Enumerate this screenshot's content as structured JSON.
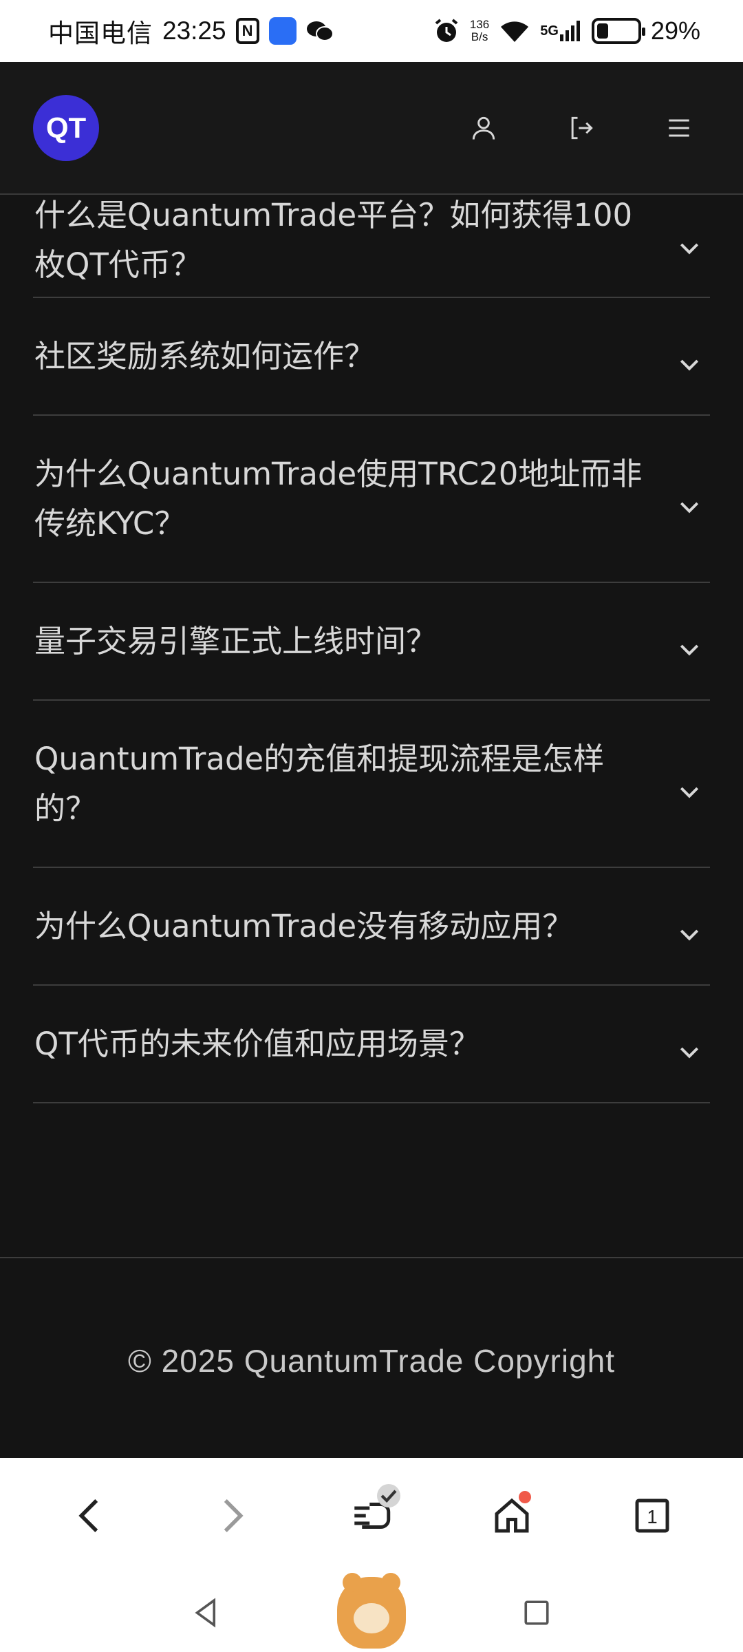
{
  "status_bar": {
    "carrier": "中国电信",
    "time": "23:25",
    "nfc_label": "N",
    "net_speed_value": "136",
    "net_speed_unit": "B/s",
    "network": "5G",
    "battery_percent": "29%",
    "battery_level": 0.29,
    "icons": [
      "nfc-icon",
      "app-notification-icon",
      "wechat-icon",
      "alarm-icon",
      "wifi-icon",
      "signal-icon",
      "battery-icon"
    ]
  },
  "header": {
    "logo_text": "QT",
    "logo_color": "#3b2fd6",
    "icons": [
      "user-icon",
      "logout-icon",
      "menu-icon"
    ]
  },
  "faq": {
    "items": [
      {
        "question": "什么是QuantumTrade平台？如何获得100枚QT代币？"
      },
      {
        "question": "社区奖励系统如何运作？"
      },
      {
        "question": "为什么QuantumTrade使用TRC20地址而非传统KYC？"
      },
      {
        "question": "量子交易引擎正式上线时间？"
      },
      {
        "question": "QuantumTrade的充值和提现流程是怎样的？"
      },
      {
        "question": "为什么QuantumTrade没有移动应用？"
      },
      {
        "question": "QT代币的未来价值和应用场景？"
      }
    ]
  },
  "footer": {
    "copyright": "© 2025 QuantumTrade Copyright"
  },
  "browser_toolbar": {
    "icons": [
      "back-icon",
      "forward-icon",
      "downloads-icon",
      "home-icon",
      "tabs-icon"
    ],
    "tabs_count": "1"
  },
  "system_nav": {
    "icons": [
      "nav-back-icon",
      "mascot-home-icon",
      "recents-icon"
    ]
  }
}
